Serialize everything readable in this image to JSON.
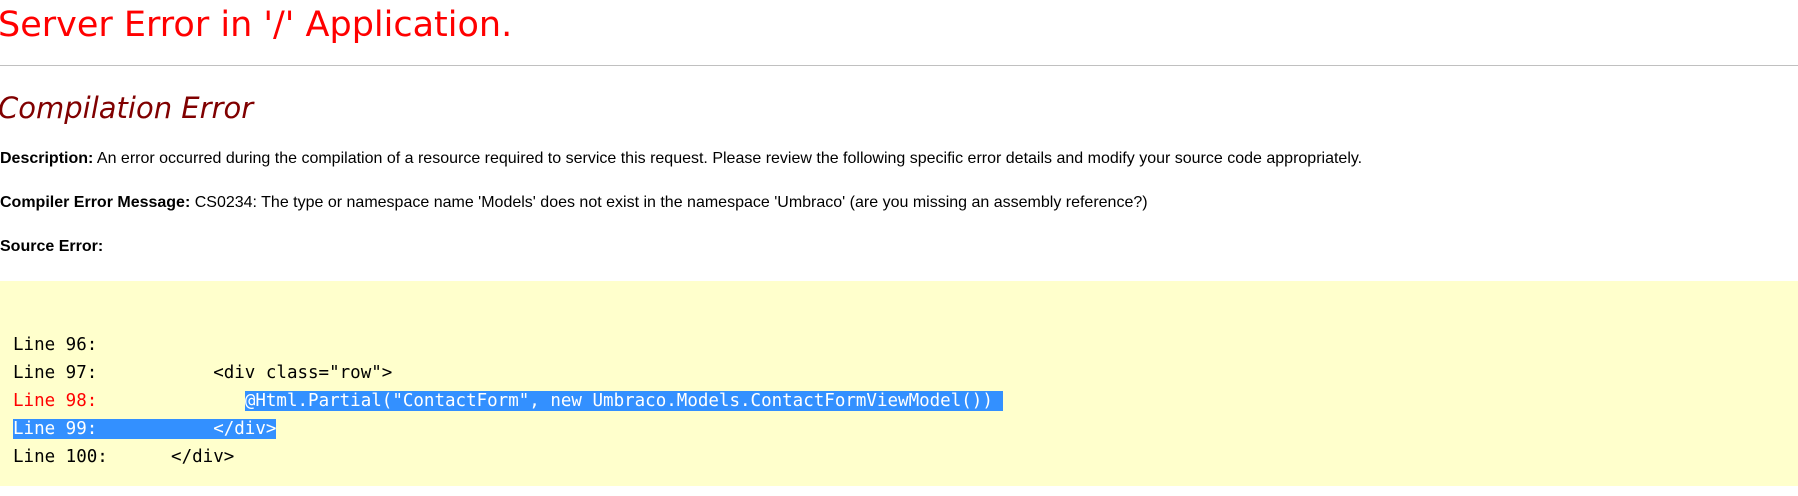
{
  "page": {
    "title": "Server Error in '/' Application.",
    "subtitle": "Compilation Error",
    "description_label": "Description:",
    "description_text": " An error occurred during the compilation of a resource required to service this request. Please review the following specific error details and modify your source code appropriately.",
    "compiler_label": "Compiler Error Message:",
    "compiler_text": " CS0234: The type or namespace name 'Models' does not exist in the namespace 'Umbraco' (are you missing an assembly reference?)",
    "source_label": "Source Error:"
  },
  "source_lines": [
    {
      "label": "Line 96:",
      "code": ""
    },
    {
      "label": "Line 97:",
      "code": "<div class=\"row\">"
    },
    {
      "label": "Line 98:",
      "code": "@Html.Partial(\"ContactForm\", new Umbraco.Models.ContactFormViewModel())"
    },
    {
      "label": "Line 99:",
      "code": "</div>"
    },
    {
      "label": "Line 100:",
      "code": "</div>"
    }
  ],
  "colors": {
    "title": "#ff0000",
    "subtitle": "#800000",
    "error_line": "#ff0000",
    "code_background": "#ffffcc",
    "selection": "#3390ff"
  }
}
